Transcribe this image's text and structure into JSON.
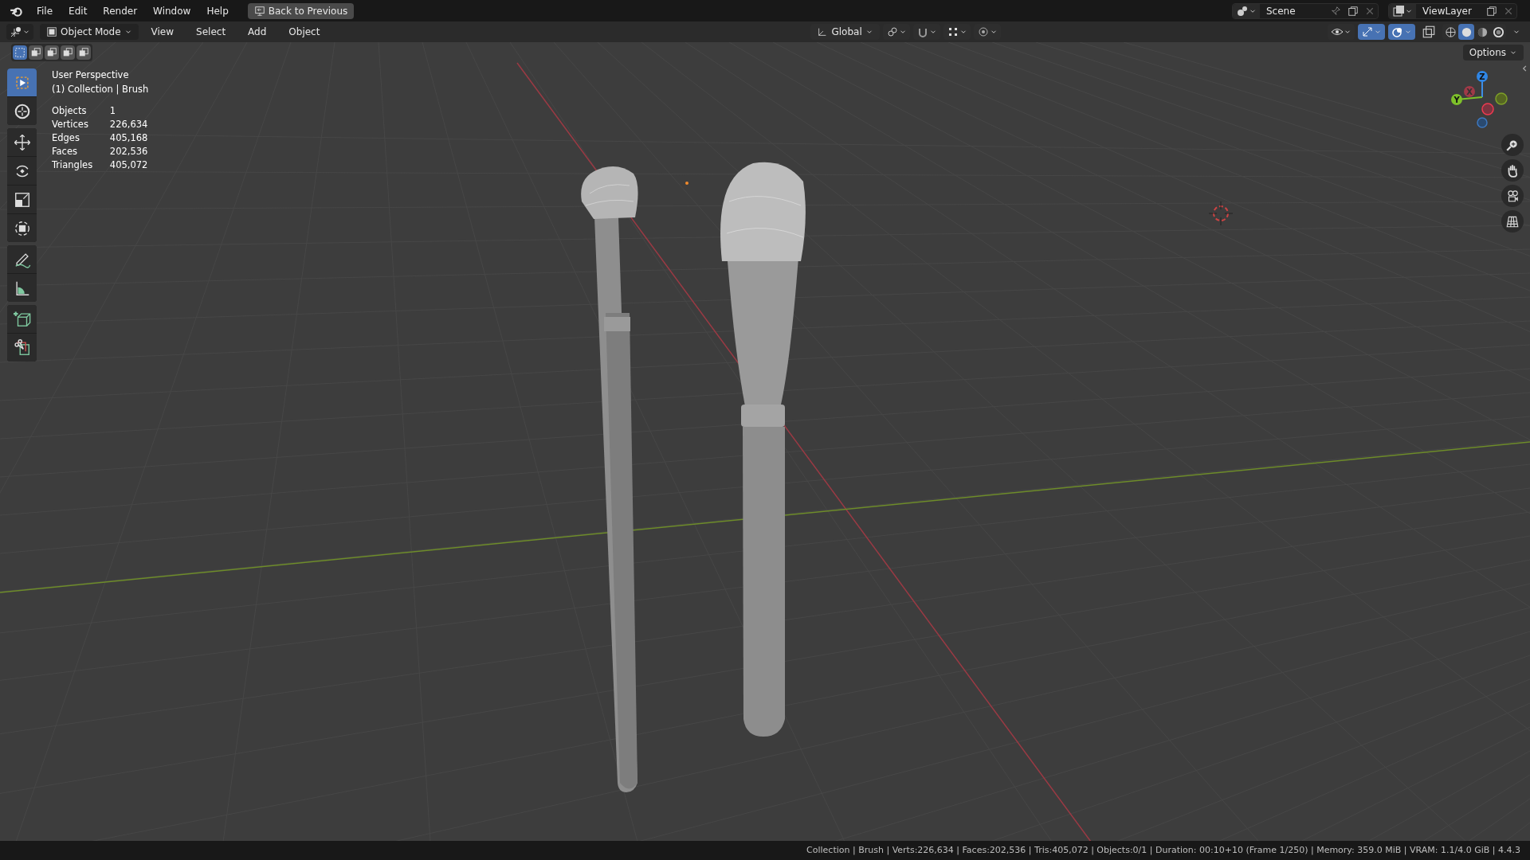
{
  "menu_bar": {
    "items": [
      "File",
      "Edit",
      "Render",
      "Window",
      "Help"
    ],
    "back_button": "Back to Previous",
    "scene": "Scene",
    "view_layer": "ViewLayer"
  },
  "header": {
    "mode": "Object Mode",
    "menus": [
      "View",
      "Select",
      "Add",
      "Object"
    ],
    "orientation": "Global",
    "shading": [
      {
        "selected": false
      },
      {
        "selected": true
      },
      {
        "selected": false
      },
      {
        "selected": false
      }
    ]
  },
  "select_modes": [
    {
      "selected": true
    },
    {
      "selected": false
    },
    {
      "selected": false
    },
    {
      "selected": false
    },
    {
      "selected": false
    }
  ],
  "toolbar": [
    {
      "kind": "select",
      "selected": true
    },
    {
      "kind": "cursor",
      "selected": false
    },
    {
      "kind": "move",
      "selected": false
    },
    {
      "kind": "rotate",
      "selected": false
    },
    {
      "kind": "scale",
      "selected": false
    },
    {
      "kind": "transform",
      "selected": false
    },
    {
      "kind": "annotate",
      "selected": false
    },
    {
      "kind": "measure",
      "selected": false
    },
    {
      "kind": "add",
      "selected": false
    },
    {
      "kind": "cut",
      "selected": false
    }
  ],
  "overlay": {
    "view": "User Perspective",
    "context": "(1) Collection | Brush",
    "stats": [
      {
        "label": "Objects",
        "value": "1"
      },
      {
        "label": "Vertices",
        "value": "226,634"
      },
      {
        "label": "Edges",
        "value": "405,168"
      },
      {
        "label": "Faces",
        "value": "202,536"
      },
      {
        "label": "Triangles",
        "value": "405,072"
      }
    ]
  },
  "options": "Options",
  "gizmo": {
    "axes": [
      "Z",
      "X",
      "Y"
    ]
  },
  "status_bar": "Collection | Brush | Verts:226,634 | Faces:202,536 | Tris:405,072 | Objects:0/1 | Duration: 00:10+10 (Frame 1/250) | Memory: 359.0 MiB | VRAM: 1.1/4.0 GiB | 4.4.3"
}
